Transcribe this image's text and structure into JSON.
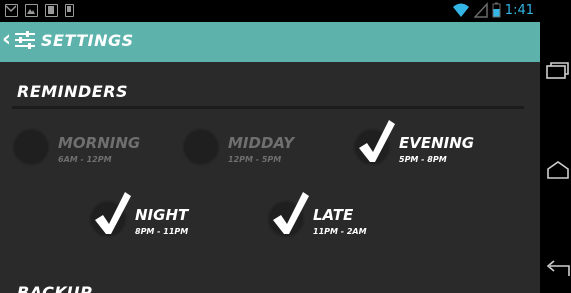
{
  "status_bar": {
    "time": "1:41",
    "icons": [
      "gmail-icon",
      "image-icon",
      "film-icon",
      "phone-icon",
      "wifi-icon",
      "signal-icon",
      "battery-icon"
    ]
  },
  "action_bar": {
    "title": "SETTINGS",
    "back_icon": "back-chevron-icon",
    "settings_icon": "sliders-icon"
  },
  "sections": {
    "reminders": {
      "title": "REMINDERS"
    },
    "backup": {
      "title": "BACKUP"
    }
  },
  "reminders": [
    {
      "name": "MORNING",
      "range": "6AM - 12PM",
      "checked": false
    },
    {
      "name": "MIDDAY",
      "range": "12PM - 5PM",
      "checked": false
    },
    {
      "name": "EVENING",
      "range": "5PM - 8PM",
      "checked": true
    },
    {
      "name": "NIGHT",
      "range": "8PM - 11PM",
      "checked": true
    },
    {
      "name": "LATE",
      "range": "11PM - 2AM",
      "checked": true
    }
  ],
  "colors": {
    "accent": "#5db3ac",
    "background": "#2a2a2a",
    "status_accent": "#33b5e5",
    "inactive_text": "#6f6f6f"
  },
  "nav_bar": {
    "buttons": [
      "recent-apps-icon",
      "home-icon",
      "back-icon"
    ]
  }
}
